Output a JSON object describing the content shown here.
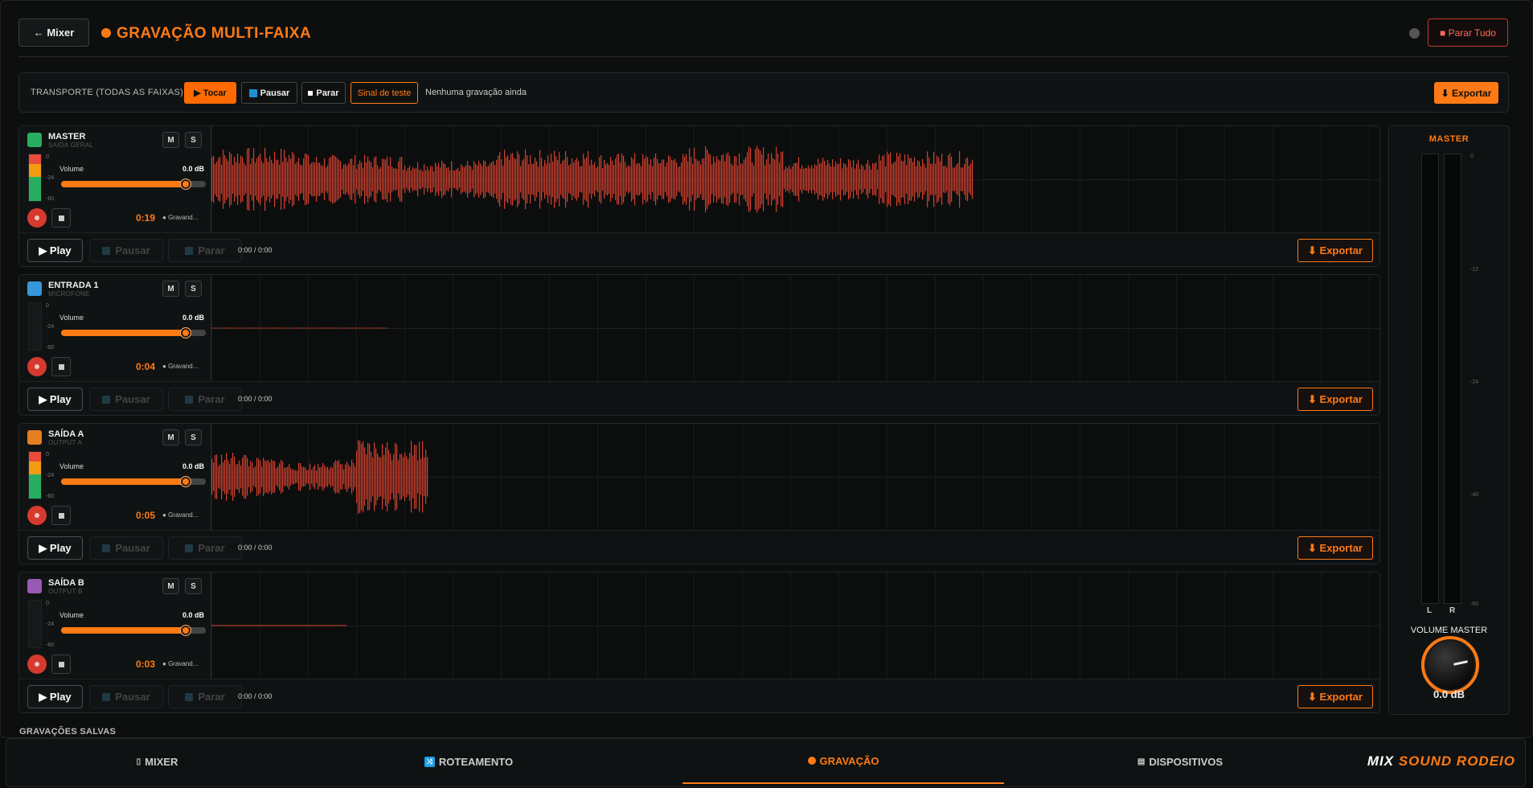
{
  "header": {
    "back_label": "← Mixer",
    "title": "GRAVAÇÃO MULTI-FAIXA",
    "stop_all_label": "■ Parar Tudo"
  },
  "transport": {
    "label": "TRANSPORTE (TODAS AS FAIXAS):",
    "play_label": "▶ Tocar",
    "pause_label": "Pausar",
    "stop_label": "Parar",
    "test_label": "Sinal de teste",
    "status": "Nenhuma gravação ainda",
    "export_label": "⬇ Exportar"
  },
  "tracks": [
    {
      "name": "MASTER",
      "sub": "SAÍDA GERAL",
      "color": "#27ae60",
      "volume_label": "Volume",
      "volume_value": "0.0 dB",
      "volume_level": 0.86,
      "time": "0:19",
      "status": "Gravand...",
      "db_ticks": [
        "0",
        "-24",
        "-60"
      ],
      "meter_active": true,
      "playback_time": "0:00 / 0:00"
    },
    {
      "name": "ENTRADA 1",
      "sub": "MICROFONE",
      "color": "#3498db",
      "volume_label": "Volume",
      "volume_value": "0.0 dB",
      "volume_level": 0.86,
      "time": "0:04",
      "status": "Gravand...",
      "db_ticks": [
        "0",
        "-24",
        "-60"
      ],
      "meter_active": false,
      "playback_time": "0:00 / 0:00"
    },
    {
      "name": "SAÍDA A",
      "sub": "OUTPUT A",
      "color": "#e67e22",
      "volume_label": "Volume",
      "volume_value": "0.0 dB",
      "volume_level": 0.86,
      "time": "0:05",
      "status": "Gravand...",
      "db_ticks": [
        "0",
        "-24",
        "-60"
      ],
      "meter_active": true,
      "playback_time": "0:00 / 0:00"
    },
    {
      "name": "SAÍDA B",
      "sub": "OUTPUT B",
      "color": "#9b59b6",
      "volume_label": "Volume",
      "volume_value": "0.0 dB",
      "volume_level": 0.86,
      "time": "0:03",
      "status": "Gravand...",
      "db_ticks": [
        "0",
        "-24",
        "-60"
      ],
      "meter_active": false,
      "playback_time": "0:00 / 0:00"
    }
  ],
  "track_buttons": {
    "mute": "M",
    "solo": "S",
    "play": "▶ Play",
    "pause": "Pausar",
    "stop": "Parar",
    "export": "⬇ Exportar"
  },
  "master_panel": {
    "title": "MASTER",
    "left": "L",
    "right": "R",
    "ticks": [
      "0",
      "-12",
      "-24",
      "-40",
      "-60"
    ],
    "volume_label": "VOLUME MASTER",
    "volume_value": "0.0 dB"
  },
  "saved_label": "GRAVAÇÕES SALVAS",
  "nav": {
    "mixer": "MIXER",
    "routing": "ROTEAMENTO",
    "recording": "GRAVAÇÃO",
    "devices": "DISPOSITIVOS",
    "brand_1": "MIX",
    "brand_2": "SOUND RODEIO"
  },
  "colors": {
    "accent": "#ff7a14",
    "record": "#d63a2e",
    "waveform": "#d4402e"
  }
}
